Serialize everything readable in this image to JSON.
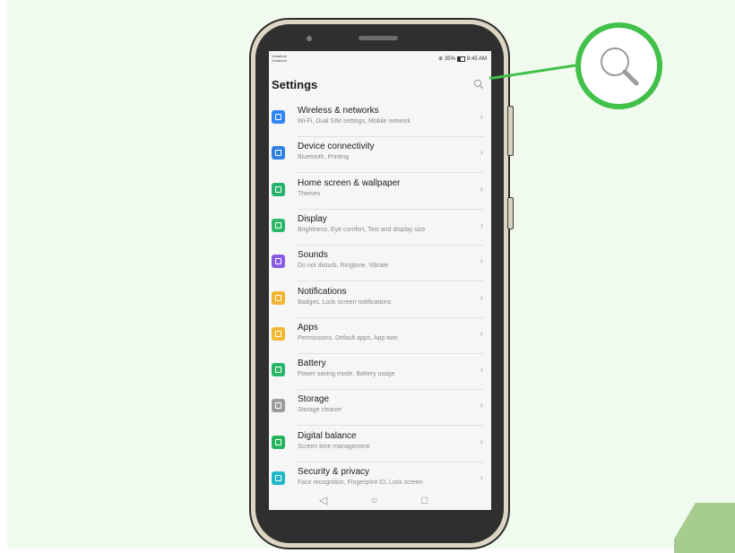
{
  "status_bar": {
    "carrier_line1": "Vodafone",
    "carrier_line2": "Vodafone",
    "battery_text": "35%",
    "time": "8:45 AM"
  },
  "header": {
    "title": "Settings"
  },
  "settings_items": [
    {
      "label": "Wireless & networks",
      "subtitle": "Wi-Fi, Dual SIM settings, Mobile network",
      "icon": "wifi-icon",
      "color": "#2e86f5"
    },
    {
      "label": "Device connectivity",
      "subtitle": "Bluetooth, Printing",
      "icon": "device-connectivity-icon",
      "color": "#2f80e6"
    },
    {
      "label": "Home screen & wallpaper",
      "subtitle": "Themes",
      "icon": "wallpaper-icon",
      "color": "#26b36b"
    },
    {
      "label": "Display",
      "subtitle": "Brightness, Eye comfort, Text and display size",
      "icon": "display-icon",
      "color": "#2eb96a"
    },
    {
      "label": "Sounds",
      "subtitle": "Do not disturb, Ringtone, Vibrate",
      "icon": "sound-icon",
      "color": "#8a5ce6"
    },
    {
      "label": "Notifications",
      "subtitle": "Badges, Lock screen notifications",
      "icon": "notifications-icon",
      "color": "#f2b431"
    },
    {
      "label": "Apps",
      "subtitle": "Permissions, Default apps, App twin",
      "icon": "apps-icon",
      "color": "#f4b830"
    },
    {
      "label": "Battery",
      "subtitle": "Power saving mode, Battery usage",
      "icon": "battery-icon",
      "color": "#2bb667"
    },
    {
      "label": "Storage",
      "subtitle": "Storage cleaner",
      "icon": "storage-icon",
      "color": "#9c9c9c"
    },
    {
      "label": "Digital balance",
      "subtitle": "Screen time management",
      "icon": "digital-balance-icon",
      "color": "#22b35c"
    },
    {
      "label": "Security & privacy",
      "subtitle": "Face recognition, Fingerprint ID, Lock screen",
      "icon": "security-icon",
      "color": "#21b7c6"
    }
  ],
  "nav": {
    "back": "◁",
    "home": "○",
    "recents": "□"
  },
  "chevron": "›",
  "accent_color": "#41c04a"
}
